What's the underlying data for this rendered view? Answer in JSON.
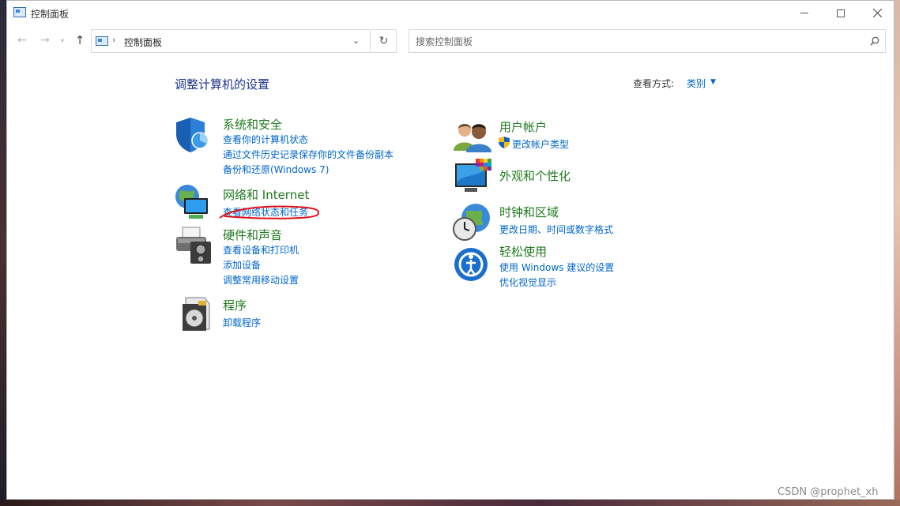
{
  "window": {
    "title": "控制面板"
  },
  "nav": {
    "breadcrumb": "控制面板",
    "separator": "›"
  },
  "search": {
    "placeholder": "搜索控制面板"
  },
  "content": {
    "heading": "调整计算机的设置",
    "view_label": "查看方式:",
    "view_value": "类别"
  },
  "categories": [
    {
      "title": "系统和安全",
      "icon": "shield-icon",
      "links": [
        "查看你的计算机状态",
        "通过文件历史记录保存你的文件备份副本",
        "备份和还原(Windows 7)"
      ]
    },
    {
      "title": "网络和 Internet",
      "icon": "network-icon",
      "links": [
        "查看网络状态和任务"
      ]
    },
    {
      "title": "硬件和声音",
      "icon": "printer-icon",
      "links": [
        "查看设备和打印机",
        "添加设备",
        "调整常用移动设置"
      ]
    },
    {
      "title": "程序",
      "icon": "programs-icon",
      "links": [
        "卸载程序"
      ]
    },
    {
      "title": "用户帐户",
      "icon": "users-icon",
      "links": [
        "更改帐户类型"
      ]
    },
    {
      "title": "外观和个性化",
      "icon": "monitor-palette-icon",
      "links": []
    },
    {
      "title": "时钟和区域",
      "icon": "clock-globe-icon",
      "links": [
        "更改日期、时间或数字格式"
      ]
    },
    {
      "title": "轻松使用",
      "icon": "accessibility-icon",
      "links": [
        "使用 Windows 建议的设置",
        "优化视觉显示"
      ]
    }
  ],
  "annotation": {
    "color": "#e0101a"
  },
  "watermark": "CSDN @prophet_xh"
}
